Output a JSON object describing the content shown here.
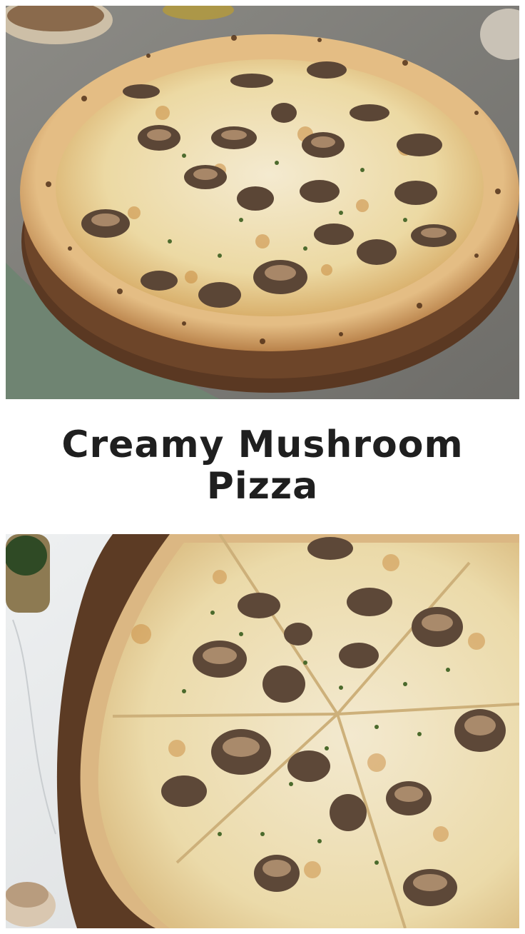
{
  "title": {
    "line1": "Creamy Mushroom",
    "line2": "Pizza"
  },
  "colors": {
    "text": "#1f1f1f",
    "background": "#ffffff",
    "crust": "#d9a86a",
    "cheese": "#f2e6b8",
    "board": "#5a3822"
  }
}
